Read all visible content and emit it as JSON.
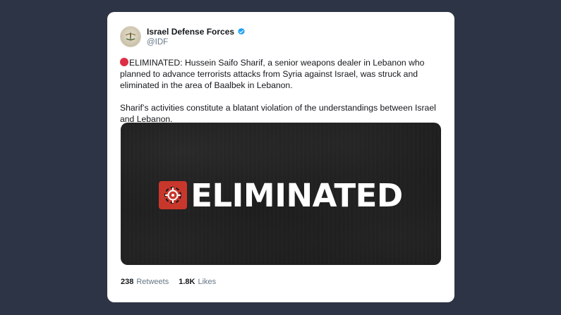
{
  "tweet": {
    "author_name": "Israel Defense Forces",
    "handle": "@IDF",
    "paragraph1": "ELIMINATED: Hussein Saifo Sharif, a senior weapons dealer in Lebanon who planned to advance terrorists attacks from Syria against Israel, was struck and eliminated in the area of Baalbek in Lebanon.",
    "paragraph2": "Sharif’s activities constitute a blatant violation of the understandings between Israel and Lebanon.",
    "media_text": "ELIMINATED",
    "retweets_count": "238",
    "retweets_label": "Retweets",
    "likes_count": "1.8K",
    "likes_label": "Likes"
  },
  "icons": {
    "avatar": "idf-emblem-icon",
    "verified": "verified-badge-icon",
    "bullet": "red-circle-icon",
    "banner": "crosshair-target-icon"
  },
  "colors": {
    "background": "#2d3445",
    "card": "#ffffff",
    "verified": "#1da1f2",
    "red_circle": "#dd2e44",
    "target_bg": "#c9372c",
    "muted_text": "#657786"
  }
}
